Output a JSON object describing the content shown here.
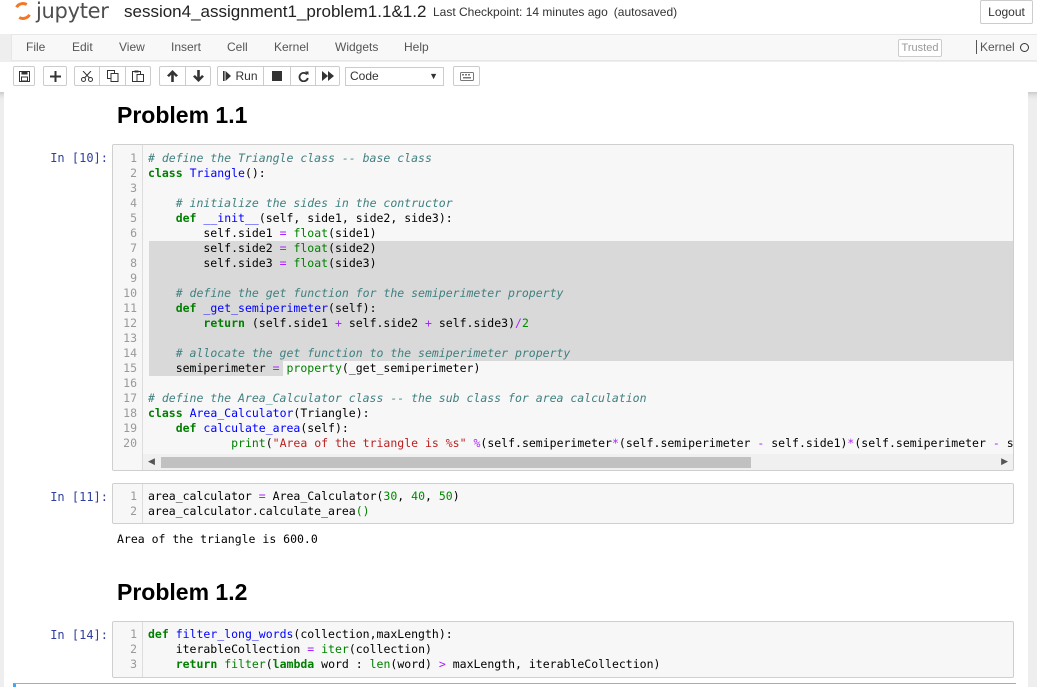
{
  "header": {
    "logo_text": "jupyter",
    "notebook_title": "session4_assignment1_problem1.1&1.2",
    "checkpoint_text": "Last Checkpoint: 14 minutes ago",
    "autosave_text": "(autosaved)",
    "logout_label": "Logout"
  },
  "menubar": {
    "items": [
      "File",
      "Edit",
      "View",
      "Insert",
      "Cell",
      "Kernel",
      "Widgets",
      "Help"
    ],
    "trusted_label": "Trusted",
    "kernel_label": "Kernel"
  },
  "toolbar": {
    "run_label": "Run",
    "cell_type": "Code"
  },
  "cells": {
    "heading1": "Problem 1.1",
    "cell1_prompt": "In [10]:",
    "cell2_prompt": "In [11]:",
    "cell2_output": "Area of the triangle is 600.0",
    "heading2": "Problem 1.2",
    "cell3_prompt": "In [14]:"
  },
  "colors": {
    "prompt": "#303f9f",
    "comment": "#408080",
    "keyword": "#008000",
    "function_name": "#0000ff",
    "operator": "#aa22ff",
    "string": "#ba2121",
    "selection": "#d9d9d9",
    "logo_orange": "#f37726"
  },
  "icons": {
    "save": "floppy-disk-icon",
    "add": "plus-icon",
    "cut": "scissors-icon",
    "copy": "copy-icon",
    "paste": "paste-icon",
    "up": "arrow-up-icon",
    "down": "arrow-down-icon",
    "run": "step-forward-icon",
    "stop": "stop-icon",
    "restart": "redo-icon",
    "restart_run": "fast-forward-icon",
    "keyboard": "keyboard-icon"
  }
}
